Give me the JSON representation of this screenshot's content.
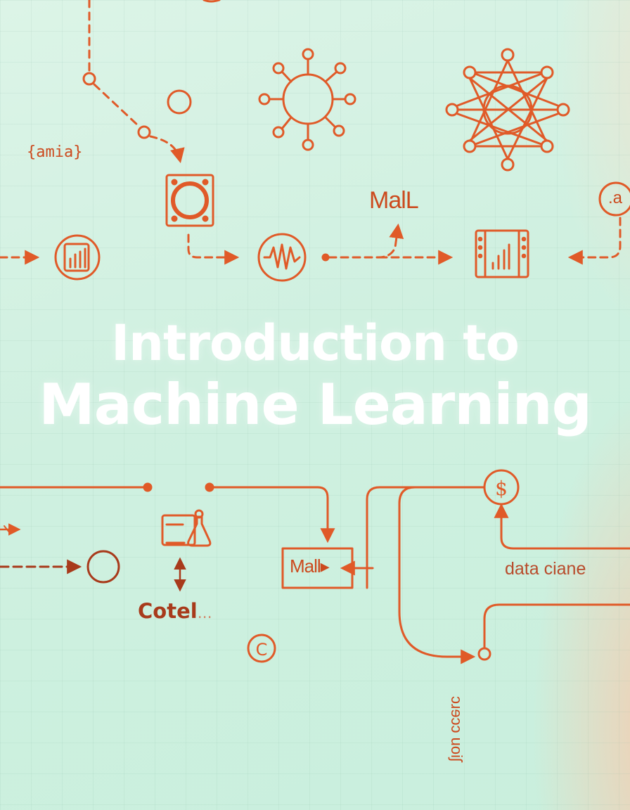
{
  "title": {
    "line1": "Introduction to",
    "line2": "Machine Learning"
  },
  "labels": {
    "amia": "{amia}",
    "mall_top": "MalL",
    "mall_box": "Mall▸",
    "data_ciane": "data ciane",
    "cotel": "Cotel",
    "cotel_suffix": "...",
    "lion": "ɔɹɘɔɔ uoiʃ",
    "corner_a": ".a",
    "c_symbol": "C",
    "dollar_symbol": "$"
  },
  "icons": [
    "network-ring-icon",
    "star-network-icon",
    "document-chart-icon",
    "square-ring-icon",
    "waveform-icon",
    "bar-chart-panel-icon",
    "card-flask-icon",
    "dollar-icon",
    "copyright-icon"
  ],
  "colors": {
    "accent": "#e05a28",
    "dark_accent": "#a83a1b",
    "title": "#ffffff"
  }
}
